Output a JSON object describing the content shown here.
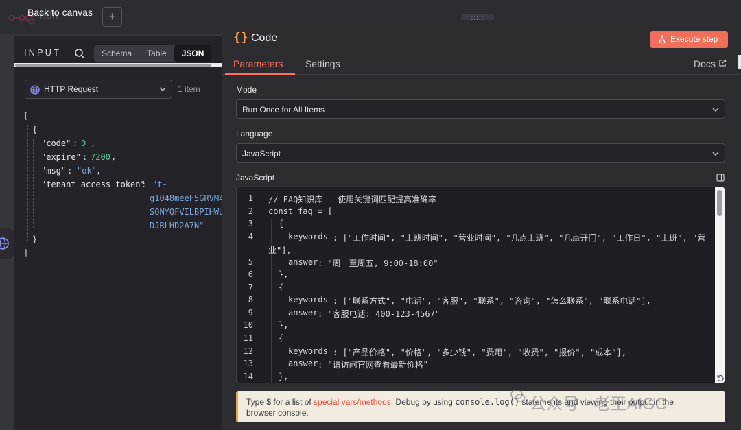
{
  "canvas": {
    "brand_name": "n8n",
    "back_label": "Back to canvas",
    "add_label": "+"
  },
  "input_panel": {
    "title": "INPUT",
    "tabs": [
      "Schema",
      "Table",
      "JSON"
    ],
    "active_tab": "JSON",
    "source_node": "HTTP Request",
    "item_count": "1 item",
    "json_lines": [
      "[",
      "{",
      "\"code\"",
      "0",
      "\"expire\"",
      "7200",
      "\"msg\"",
      "\"ok\"",
      "\"tenant_access_token\"",
      "\"t-",
      "g1048meeF5GRVM4",
      "SQNYQFVILBPIHWU",
      "DJRLHD2A7N\"",
      "}",
      "]"
    ]
  },
  "node": {
    "title": "Code",
    "execute_label": "Execute step",
    "tabs": [
      "Parameters",
      "Settings"
    ],
    "active_tab": "Parameters",
    "docs_label": "Docs",
    "mode_label": "Mode",
    "mode_value": "Run Once for All Items",
    "language_label": "Language",
    "language_value": "JavaScript",
    "editor_label": "JavaScript",
    "line_numbers": [
      "1",
      "2",
      "3",
      "4",
      "",
      "5",
      "6",
      "7",
      "8",
      "9",
      "10",
      "11",
      "12",
      "13",
      "14"
    ],
    "code": {
      "l1": "// FAQ知识库 - 使用关键词匹配提高准确率",
      "l2_kw": "const",
      "l2_name": "faq",
      "l2_rest": " = [",
      "l3": "{",
      "l4_key": "keywords",
      "l4_val": ": [\"工作时间\", \"上班时间\", \"营业时间\", \"几点上班\", \"几点开门\", \"工作日\", \"上班\", \"营",
      "l4_wrap": "业\"],",
      "l5_key": "answer",
      "l5_val": ": \"周一至周五, 9:00-18:00\"",
      "l6": "},",
      "l7": "{",
      "l8_key": "keywords",
      "l8_val": ": [\"联系方式\", \"电话\", \"客服\", \"联系\", \"咨询\", \"怎么联系\", \"联系电话\"],",
      "l9_key": "answer",
      "l9_val": ": \"客服电话: 400-123-4567\"",
      "l10": "},",
      "l11": "{",
      "l12_key": "keywords",
      "l12_val": ": [\"产品价格\", \"价格\", \"多少钱\", \"费用\", \"收费\", \"报价\", \"成本\"],",
      "l13_key": "answer",
      "l13_val": ": \"请访问官网查看最新价格\"",
      "l14": "},"
    },
    "hint": {
      "prefix": "Type $ for a list of ",
      "link": "special vars/methods",
      "middle": ". Debug by using ",
      "code": "console.log()",
      "suffix": " statements and viewing their output in the",
      "line2": "browser console."
    }
  },
  "watermark": "公众号 · 老王AIGC",
  "colors": {
    "accent": "#ff6f5c",
    "execute_button": "#ef6f5a",
    "code_icon": "#ff9b4a",
    "panel_bg": "#2c2c31",
    "hint_bg": "#f1ecdf"
  },
  "icons": [
    "search-icon",
    "globe-icon",
    "chevron-down-icon",
    "code-braces-icon",
    "flask-icon",
    "external-link-icon",
    "expand-panel-icon",
    "resize-icon"
  ]
}
